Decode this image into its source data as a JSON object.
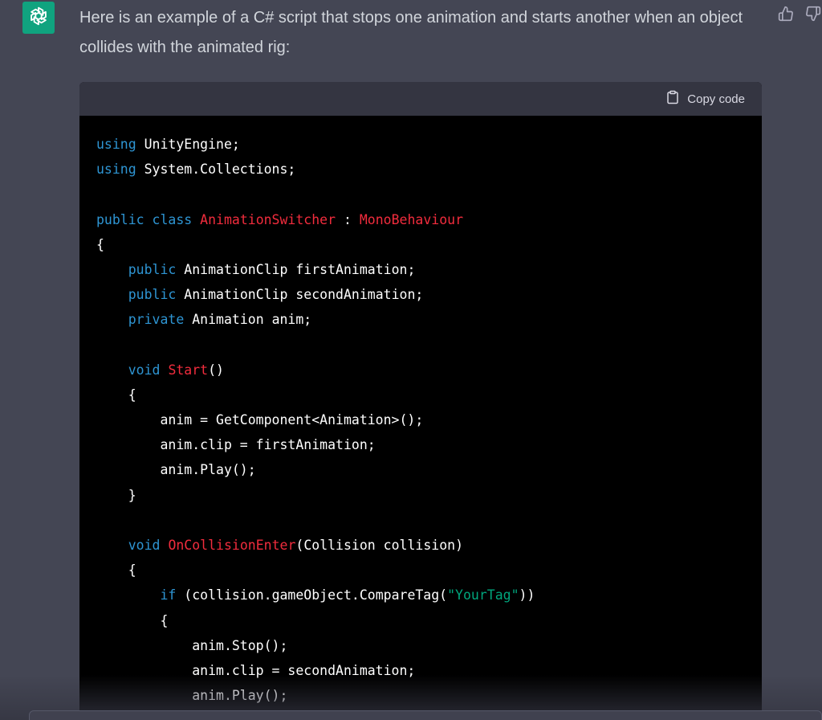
{
  "message": {
    "avatar_icon": "openai-logo-icon",
    "text": "Here is an example of a C# script that stops one animation and starts another when an object collides with the animated rig:",
    "feedback": {
      "thumbs_up_icon": "thumbs-up-icon",
      "thumbs_down_icon": "thumbs-down-icon"
    }
  },
  "code_block": {
    "copy_label": "Copy code",
    "copy_icon": "clipboard-icon",
    "lines": [
      {
        "tokens": [
          {
            "t": "using",
            "c": "kw"
          },
          {
            "t": " UnityEngine;",
            "c": ""
          }
        ]
      },
      {
        "tokens": [
          {
            "t": "using",
            "c": "kw"
          },
          {
            "t": " System.Collections;",
            "c": ""
          }
        ]
      },
      {
        "tokens": []
      },
      {
        "tokens": [
          {
            "t": "public",
            "c": "kw"
          },
          {
            "t": " ",
            "c": ""
          },
          {
            "t": "class",
            "c": "kw"
          },
          {
            "t": " ",
            "c": ""
          },
          {
            "t": "AnimationSwitcher",
            "c": "cls"
          },
          {
            "t": " : ",
            "c": ""
          },
          {
            "t": "MonoBehaviour",
            "c": "cls"
          }
        ]
      },
      {
        "tokens": [
          {
            "t": "{",
            "c": ""
          }
        ]
      },
      {
        "tokens": [
          {
            "t": "    ",
            "c": ""
          },
          {
            "t": "public",
            "c": "kw"
          },
          {
            "t": " AnimationClip firstAnimation;",
            "c": ""
          }
        ]
      },
      {
        "tokens": [
          {
            "t": "    ",
            "c": ""
          },
          {
            "t": "public",
            "c": "kw"
          },
          {
            "t": " AnimationClip secondAnimation;",
            "c": ""
          }
        ]
      },
      {
        "tokens": [
          {
            "t": "    ",
            "c": ""
          },
          {
            "t": "private",
            "c": "kw"
          },
          {
            "t": " Animation anim;",
            "c": ""
          }
        ]
      },
      {
        "tokens": []
      },
      {
        "tokens": [
          {
            "t": "    ",
            "c": ""
          },
          {
            "t": "void",
            "c": "kw"
          },
          {
            "t": " ",
            "c": ""
          },
          {
            "t": "Start",
            "c": "cls"
          },
          {
            "t": "()",
            "c": ""
          }
        ]
      },
      {
        "tokens": [
          {
            "t": "    {",
            "c": ""
          }
        ]
      },
      {
        "tokens": [
          {
            "t": "        anim = GetComponent<Animation>();",
            "c": ""
          }
        ]
      },
      {
        "tokens": [
          {
            "t": "        anim.clip = firstAnimation;",
            "c": ""
          }
        ]
      },
      {
        "tokens": [
          {
            "t": "        anim.Play();",
            "c": ""
          }
        ]
      },
      {
        "tokens": [
          {
            "t": "    }",
            "c": ""
          }
        ]
      },
      {
        "tokens": []
      },
      {
        "tokens": [
          {
            "t": "    ",
            "c": ""
          },
          {
            "t": "void",
            "c": "kw"
          },
          {
            "t": " ",
            "c": ""
          },
          {
            "t": "OnCollisionEnter",
            "c": "cls"
          },
          {
            "t": "(Collision collision)",
            "c": ""
          }
        ]
      },
      {
        "tokens": [
          {
            "t": "    {",
            "c": ""
          }
        ]
      },
      {
        "tokens": [
          {
            "t": "        ",
            "c": ""
          },
          {
            "t": "if",
            "c": "kw"
          },
          {
            "t": " (collision.gameObject.CompareTag(",
            "c": ""
          },
          {
            "t": "\"YourTag\"",
            "c": "str"
          },
          {
            "t": "))",
            "c": ""
          }
        ]
      },
      {
        "tokens": [
          {
            "t": "        {",
            "c": ""
          }
        ]
      },
      {
        "tokens": [
          {
            "t": "            anim.Stop();",
            "c": ""
          }
        ]
      },
      {
        "tokens": [
          {
            "t": "            anim.clip = secondAnimation;",
            "c": ""
          }
        ]
      },
      {
        "tokens": [
          {
            "t": "            anim.Play();",
            "c": ""
          }
        ]
      }
    ]
  },
  "colors": {
    "background": "#444654",
    "code_header": "#343541",
    "code_bg": "#000000",
    "keyword": "#2e95d3",
    "class_name": "#f22c3d",
    "string": "#00a67d",
    "avatar_bg": "#10a37f"
  }
}
